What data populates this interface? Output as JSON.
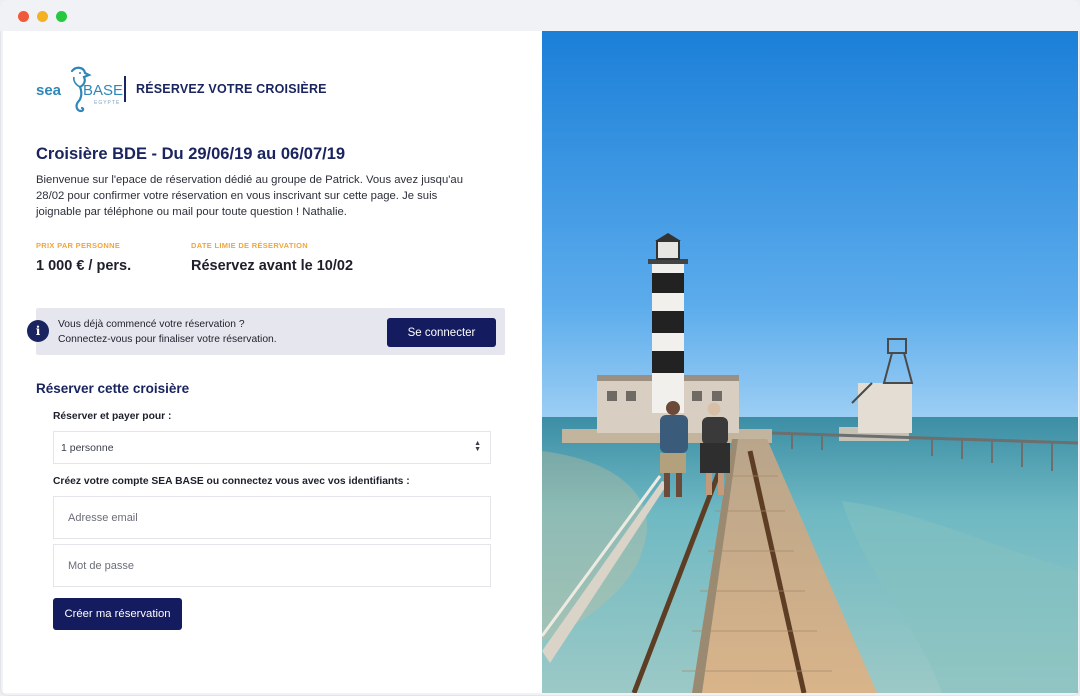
{
  "brand": {
    "word1": "sea",
    "word2": "BASE",
    "word3": "EGYPTE"
  },
  "header": {
    "title": "RÉSERVEZ VOTRE CROISIÈRE"
  },
  "cruise": {
    "title": "Croisière BDE - Du 29/06/19 au 06/07/19",
    "intro": "Bienvenue sur l'epace de réservation dédié au groupe de Patrick. Vous avez jusqu'au 28/02 pour confirmer votre réservation en vous inscrivant sur cette page. Je suis joignable par téléphone ou mail pour toute question ! Nathalie."
  },
  "price": {
    "label": "PRIX PAR PERSONNE",
    "value": "1 000 € / pers."
  },
  "deadline": {
    "label": "DATE LIMIE DE RÉSERVATION",
    "value": "Réservez avant le 10/02"
  },
  "notice": {
    "icon": "info-icon",
    "line1": "Vous déjà commencé votre réservation ?",
    "line2": "Connectez-vous pour finaliser votre réservation.",
    "button": "Se connecter"
  },
  "booking": {
    "title": "Réserver cette croisière",
    "pay_for_label": "Réserver et payer pour :",
    "pay_for_value": "1 personne",
    "account_label": "Créez votre compte SEA BASE ou connectez vous avec vos identifiants :",
    "email_placeholder": "Adresse email",
    "password_placeholder": "Mot de passe",
    "submit": "Créer ma réservation"
  },
  "colors": {
    "navy": "#141b5e",
    "accent": "#f0a63a",
    "sea_blue": "#2f86b8"
  }
}
